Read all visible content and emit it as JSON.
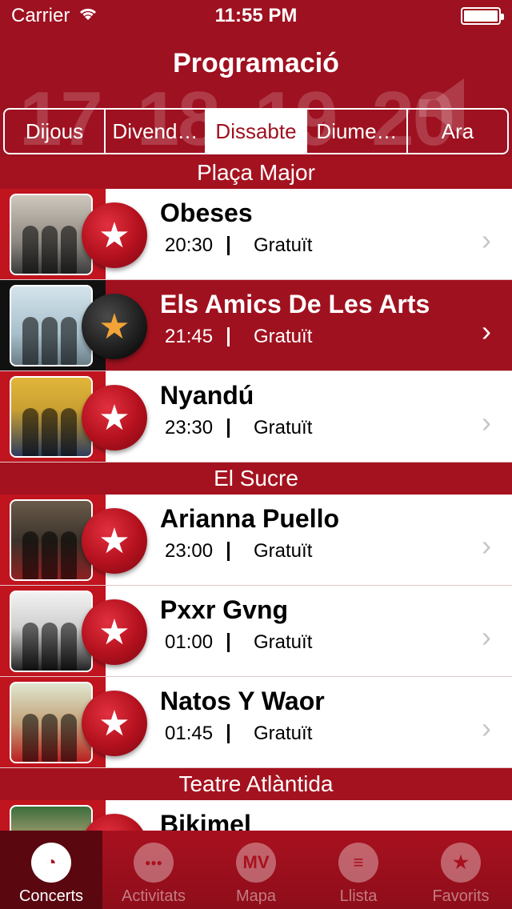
{
  "status": {
    "carrier": "Carrier",
    "time": "11:55 PM"
  },
  "header": {
    "title": "Programació",
    "bg_dates": [
      "17",
      "18",
      "19",
      "20"
    ]
  },
  "segments": [
    {
      "label": "Dijous",
      "active": false
    },
    {
      "label": "Divend…",
      "active": false
    },
    {
      "label": "Dissabte",
      "active": true
    },
    {
      "label": "Diume…",
      "active": false
    },
    {
      "label": "Ara",
      "active": false
    }
  ],
  "sections": [
    {
      "title": "Plaça Major",
      "rows": [
        {
          "name": "Obeses",
          "time": "20:30",
          "price": "Gratuït",
          "highlight": false
        },
        {
          "name": "Els Amics De Les Arts",
          "time": "21:45",
          "price": "Gratuït",
          "highlight": true
        },
        {
          "name": "Nyandú",
          "time": "23:30",
          "price": "Gratuït",
          "highlight": false
        }
      ]
    },
    {
      "title": "El Sucre",
      "rows": [
        {
          "name": "Arianna Puello",
          "time": "23:00",
          "price": "Gratuït",
          "highlight": false
        },
        {
          "name": "Pxxr Gvng",
          "time": "01:00",
          "price": "Gratuït",
          "highlight": false
        },
        {
          "name": "Natos Y Waor",
          "time": "01:45",
          "price": "Gratuït",
          "highlight": false
        }
      ]
    },
    {
      "title": "Teatre Atlàntida",
      "rows": [
        {
          "name": "Bikimel",
          "time": "",
          "price": "",
          "highlight": false
        }
      ]
    }
  ],
  "tabs": [
    {
      "label": "Concerts",
      "icon": "concerts-icon",
      "active": true
    },
    {
      "label": "Activitats",
      "icon": "activitats-icon",
      "active": false
    },
    {
      "label": "Mapa",
      "icon": "mapa-icon",
      "icon_text": "MV",
      "active": false
    },
    {
      "label": "Llista",
      "icon": "llista-icon",
      "active": false
    },
    {
      "label": "Favorits",
      "icon": "favorits-icon",
      "active": false
    }
  ],
  "colors": {
    "brand": "#9e1120",
    "tab_active": "#5a0710",
    "star_highlight": "#f3a437"
  }
}
